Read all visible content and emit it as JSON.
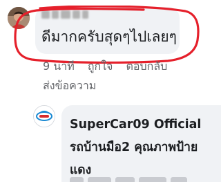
{
  "comment": {
    "text": "ดีมากครับสุดๆไปเลยๆ",
    "time": "9 นาที",
    "like_label": "ถูกใจ",
    "reply_label": "ตอบกลับ",
    "send_message_label": "ส่งข้อความ"
  },
  "reply": {
    "author": "SuperCar09 Official รถบ้านมือ2 คุณภาพป้ายแดง"
  },
  "colors": {
    "bubble": "#f0f2f5",
    "annotation_ring": "#e5202b",
    "meta_text": "#65676b"
  }
}
